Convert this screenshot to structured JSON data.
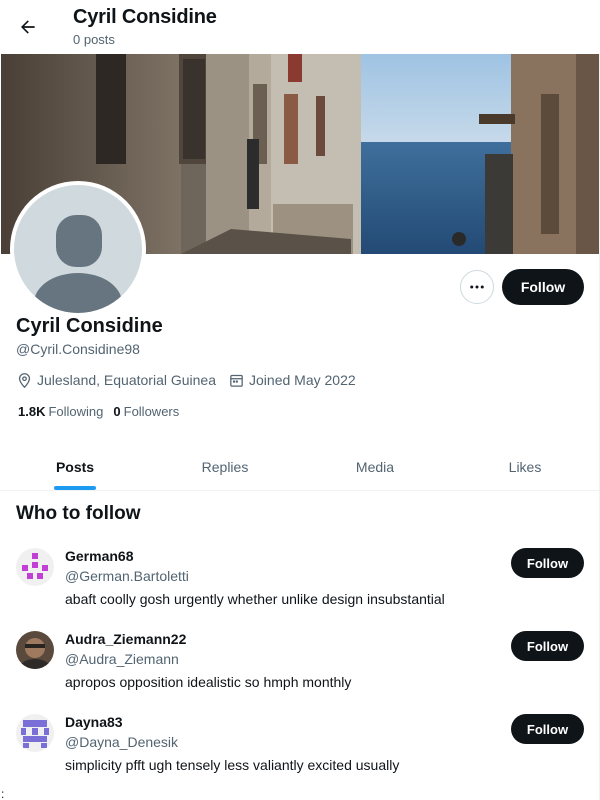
{
  "header": {
    "title": "Cyril Considine",
    "subtitle": "0 posts"
  },
  "profile": {
    "name": "Cyril Considine",
    "handle": "@Cyril.Considine98",
    "location": "Julesland, Equatorial Guinea",
    "joined": "Joined May 2022",
    "following_count": "1.8K",
    "following_label": "Following",
    "followers_count": "0",
    "followers_label": "Followers",
    "follow_label": "Follow"
  },
  "tabs": [
    {
      "label": "Posts",
      "active": true
    },
    {
      "label": "Replies",
      "active": false
    },
    {
      "label": "Media",
      "active": false
    },
    {
      "label": "Likes",
      "active": false
    }
  ],
  "who_to_follow": {
    "title": "Who to follow",
    "users": [
      {
        "name": "German68",
        "handle": "@German.Bartoletti",
        "bio": "abaft coolly gosh urgently whether unlike design insubstantial",
        "follow_label": "Follow"
      },
      {
        "name": "Audra_Ziemann22",
        "handle": "@Audra_Ziemann",
        "bio": "apropos opposition idealistic so hmph monthly",
        "follow_label": "Follow"
      },
      {
        "name": "Dayna83",
        "handle": "@Dayna_Denesik",
        "bio": "simplicity pfft ugh tensely less valiantly excited usually",
        "follow_label": "Follow"
      }
    ]
  },
  "stray_text": ":",
  "colors": {
    "accent": "#1d9bf0",
    "button_dark": "#0f1419",
    "secondary_text": "#536471",
    "identicon_german": "#c23fd6",
    "identicon_dayna": "#7a6fd6"
  }
}
